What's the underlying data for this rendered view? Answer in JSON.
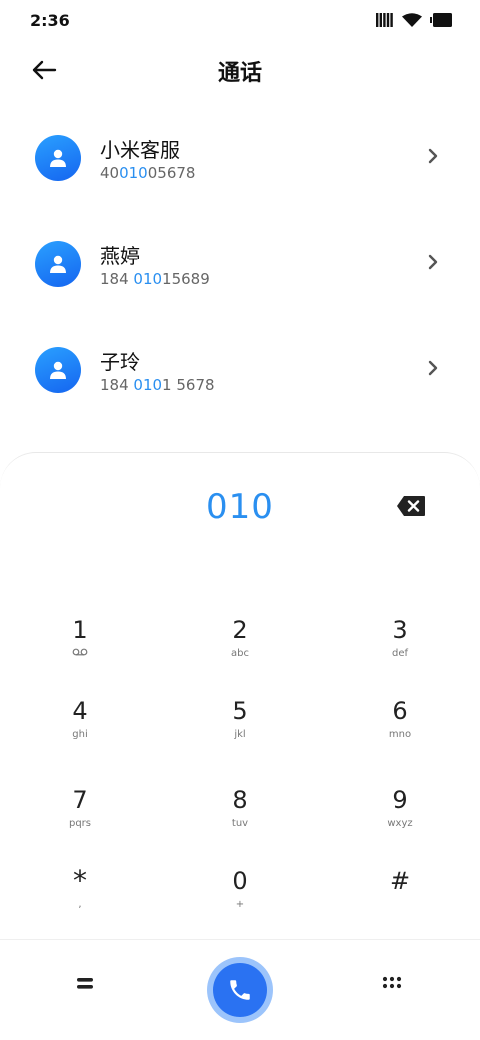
{
  "status_bar": {
    "time": "2:36",
    "icons": [
      "signal-icon",
      "wifi-icon",
      "battery-icon"
    ]
  },
  "header": {
    "title": "通话",
    "back_icon": "back-arrow-icon"
  },
  "contacts": [
    {
      "name": "小米客服",
      "number_parts": [
        "40",
        "010",
        "05678"
      ]
    },
    {
      "name": "燕婷",
      "number_parts": [
        "184 ",
        "010",
        "15689"
      ]
    },
    {
      "name": "子玲",
      "number_parts": [
        "184 ",
        "010",
        "1 5678"
      ]
    }
  ],
  "dialer": {
    "display": "010",
    "keys": [
      {
        "digit": "1",
        "letters": "voicemail-icon"
      },
      {
        "digit": "2",
        "letters": "abc"
      },
      {
        "digit": "3",
        "letters": "def"
      },
      {
        "digit": "4",
        "letters": "ghi"
      },
      {
        "digit": "5",
        "letters": "jkl"
      },
      {
        "digit": "6",
        "letters": "mno"
      },
      {
        "digit": "7",
        "letters": "pqrs"
      },
      {
        "digit": "8",
        "letters": "tuv"
      },
      {
        "digit": "9",
        "letters": "wxyz"
      },
      {
        "digit": "*",
        "letters": ","
      },
      {
        "digit": "0",
        "letters": "+"
      },
      {
        "digit": "#",
        "letters": ""
      }
    ]
  },
  "colors": {
    "accent": "#2a8ff0",
    "call_button": "#2a72f2",
    "call_button_ring": "#9cc4fb"
  }
}
